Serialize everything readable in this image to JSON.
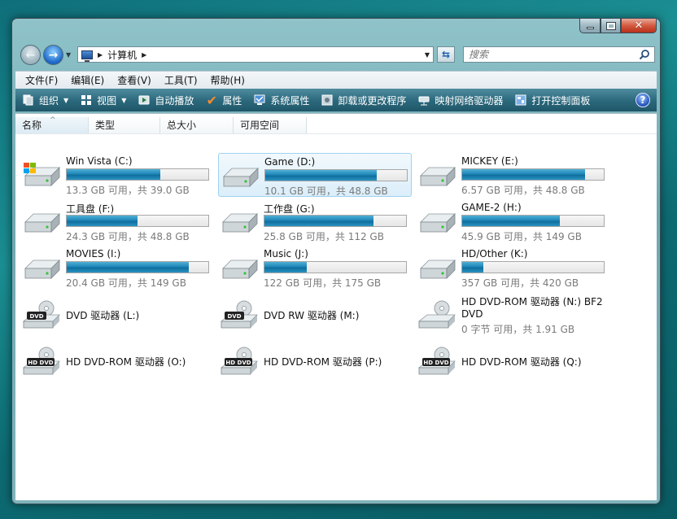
{
  "window": {
    "address": {
      "segments": [
        "计算机"
      ]
    },
    "search": {
      "placeholder": "搜索"
    }
  },
  "menubar": {
    "items": [
      "文件(F)",
      "编辑(E)",
      "查看(V)",
      "工具(T)",
      "帮助(H)"
    ]
  },
  "toolbar": {
    "items": [
      {
        "label": "组织",
        "icon": "organize-icon",
        "dropdown": true
      },
      {
        "label": "视图",
        "icon": "views-icon",
        "dropdown": true
      },
      {
        "label": "自动播放",
        "icon": "autoplay-icon"
      },
      {
        "label": "属性",
        "icon": "checkmark-icon"
      },
      {
        "label": "系统属性",
        "icon": "system-properties-icon"
      },
      {
        "label": "卸载或更改程序",
        "icon": "uninstall-icon"
      },
      {
        "label": "映射网络驱动器",
        "icon": "map-network-drive-icon"
      },
      {
        "label": "打开控制面板",
        "icon": "control-panel-icon"
      }
    ],
    "help": "?"
  },
  "columns": [
    "名称",
    "类型",
    "总大小",
    "可用空间"
  ],
  "drives": [
    {
      "name": "Win Vista (C:)",
      "icon": "windows-drive-icon",
      "info": "13.3 GB 可用，共 39.0 GB",
      "used_fraction": 0.66
    },
    {
      "name": "Game (D:)",
      "icon": "hard-drive-icon",
      "info": "10.1 GB 可用，共 48.8 GB",
      "used_fraction": 0.79,
      "selected": true
    },
    {
      "name": "MICKEY (E:)",
      "icon": "hard-drive-icon",
      "info": "6.57 GB 可用，共 48.8 GB",
      "used_fraction": 0.87
    },
    {
      "name": "工具盘 (F:)",
      "icon": "hard-drive-icon",
      "info": "24.3 GB 可用，共 48.8 GB",
      "used_fraction": 0.5
    },
    {
      "name": "工作盘 (G:)",
      "icon": "hard-drive-icon",
      "info": "25.8 GB 可用，共 112 GB",
      "used_fraction": 0.77
    },
    {
      "name": "GAME-2 (H:)",
      "icon": "hard-drive-icon",
      "info": "45.9 GB 可用，共 149 GB",
      "used_fraction": 0.69
    },
    {
      "name": "MOVIES (I:)",
      "icon": "hard-drive-icon",
      "info": "20.4 GB 可用，共 149 GB",
      "used_fraction": 0.86
    },
    {
      "name": "Music (J:)",
      "icon": "hard-drive-icon",
      "info": "122 GB 可用，共 175 GB",
      "used_fraction": 0.3
    },
    {
      "name": "HD/Other (K:)",
      "icon": "hard-drive-icon",
      "info": "357 GB 可用，共 420 GB",
      "used_fraction": 0.15
    }
  ],
  "optical": [
    {
      "name": "DVD 驱动器 (L:)",
      "icon": "dvd-drive-icon",
      "badge": "DVD"
    },
    {
      "name": "DVD RW 驱动器 (M:)",
      "icon": "dvd-rw-drive-icon",
      "badge": "DVD"
    },
    {
      "name": "HD DVD-ROM 驱动器 (N:) BF2",
      "name2": "DVD",
      "info": "0 字节 可用，共 1.91 GB",
      "icon": "hd-dvd-drive-icon",
      "badge": ""
    },
    {
      "name": "HD DVD-ROM 驱动器 (O:)",
      "icon": "hd-dvd-drive-icon",
      "badge": "HD DVD"
    },
    {
      "name": "HD DVD-ROM 驱动器 (P:)",
      "icon": "hd-dvd-drive-icon",
      "badge": "HD DVD"
    },
    {
      "name": "HD DVD-ROM 驱动器 (Q:)",
      "icon": "hd-dvd-drive-icon",
      "badge": "HD DVD"
    }
  ]
}
